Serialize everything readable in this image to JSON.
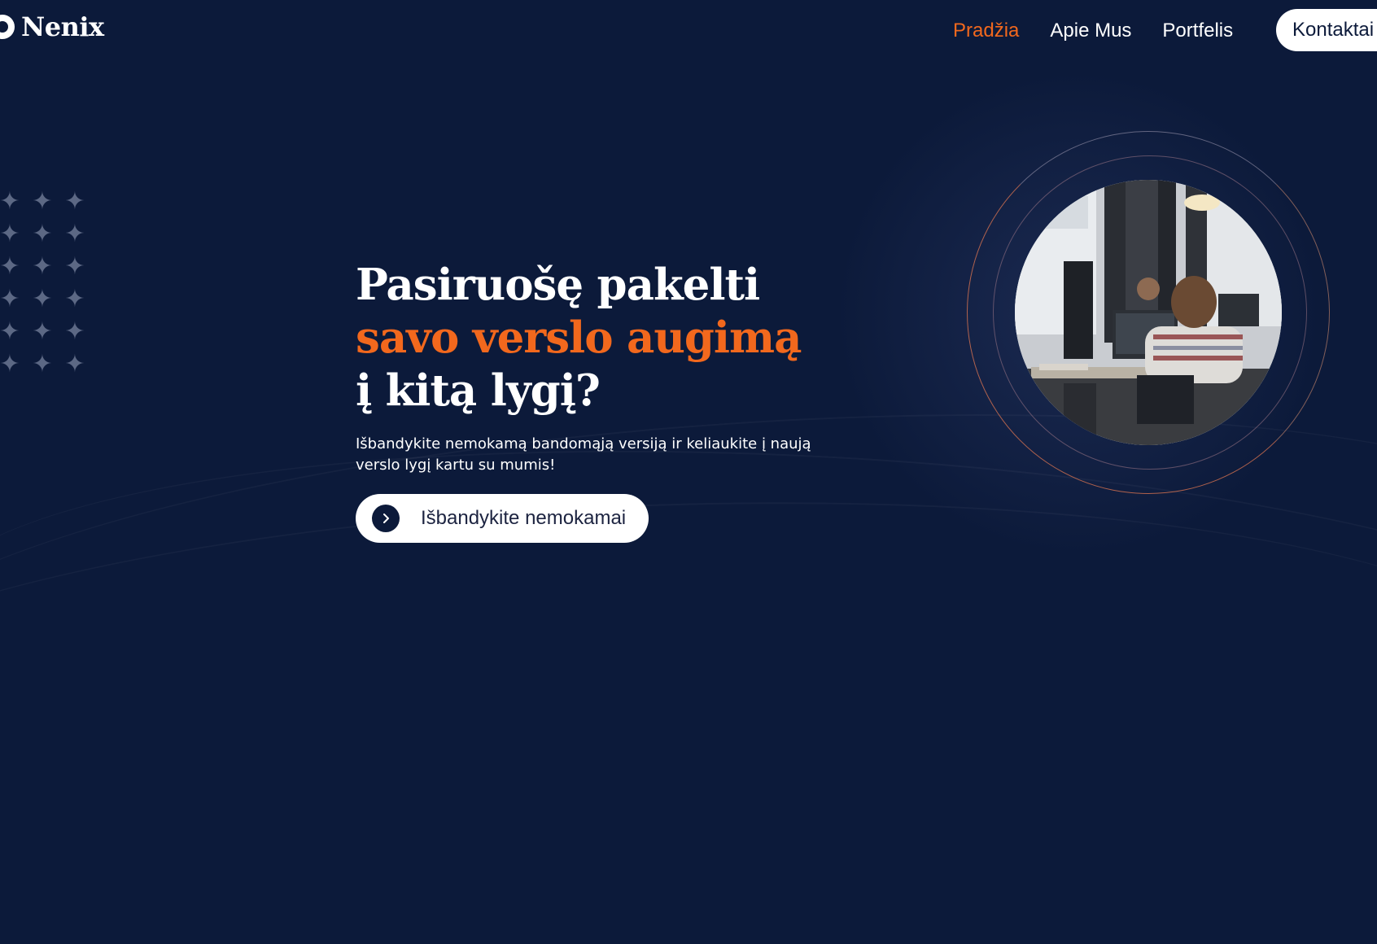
{
  "brand": {
    "name": "Nenix"
  },
  "nav": {
    "items": [
      {
        "label": "Pradžia",
        "active": true
      },
      {
        "label": "Apie Mus",
        "active": false
      },
      {
        "label": "Portfelis",
        "active": false
      }
    ],
    "cta_label": "Kontaktai"
  },
  "hero": {
    "title_line1": "Pasiruošę pakelti",
    "title_line2": "savo verslo augimą",
    "title_line3": "į kitą lygį?",
    "subtitle": "Išbandykite nemokamą bandomąją versiją ir keliaukite į naują verslo lygį kartu su mumis!",
    "cta_label": "Išbandykite nemokamai",
    "cta_icon": "chevron-right-icon"
  },
  "colors": {
    "background": "#0c1a3a",
    "accent": "#f2681d",
    "text": "#ffffff"
  }
}
